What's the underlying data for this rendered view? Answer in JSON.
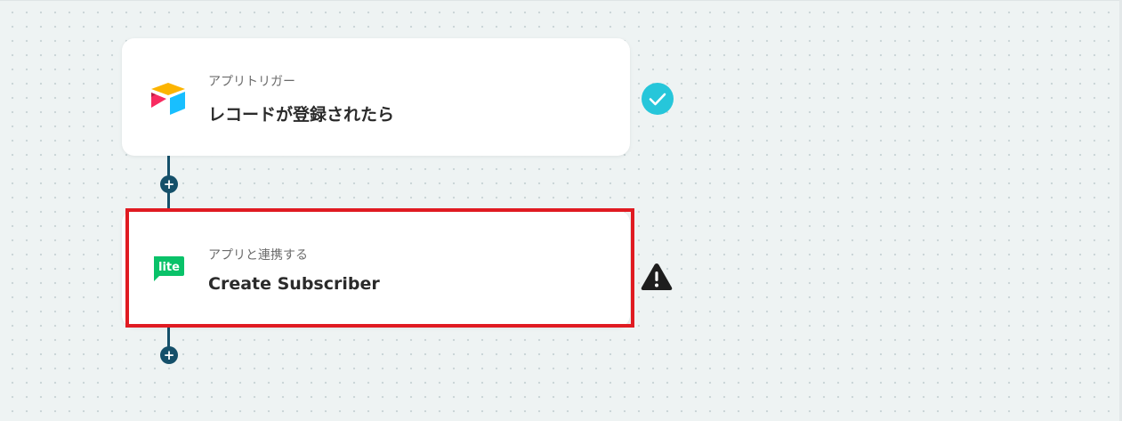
{
  "flow": {
    "steps": [
      {
        "subtitle": "アプリトリガー",
        "title": "レコードが登録されたら",
        "app_icon": "airtable-logo-icon",
        "status_icon": "check-circle-icon",
        "status_color": "#26c6da"
      },
      {
        "subtitle": "アプリと連携する",
        "title": "Create Subscriber",
        "app_icon": "mailerlite-logo-icon",
        "app_icon_text": "lite",
        "status_icon": "warning-triangle-icon",
        "status_color": "#1e1e1e"
      }
    ],
    "add_button_label": "+"
  },
  "colors": {
    "connector": "#15506a",
    "highlight_border": "#e01b22",
    "card_background": "#ffffff",
    "canvas_background": "#eef3f3"
  }
}
